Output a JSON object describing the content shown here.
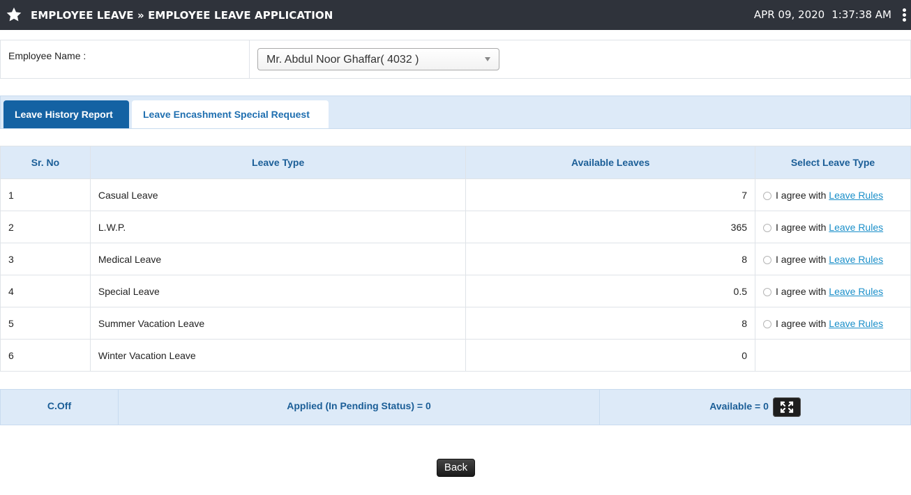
{
  "header": {
    "title": "EMPLOYEE LEAVE » EMPLOYEE LEAVE APPLICATION",
    "date": "APR 09, 2020",
    "time": "1:37:38 AM",
    "star_icon": "star-icon",
    "menu_icon": "kebab-menu-icon"
  },
  "employee": {
    "label": "Employee Name :",
    "selected": "Mr. Abdul Noor Ghaffar( 4032 )"
  },
  "tabs": [
    {
      "label": "Leave History Report",
      "active": true
    },
    {
      "label": "Leave Encashment Special Request",
      "active": false
    }
  ],
  "table": {
    "headers": [
      "Sr. No",
      "Leave Type",
      "Available Leaves",
      "Select Leave Type"
    ],
    "agree_text": "I agree with ",
    "link_text": "Leave Rules",
    "rows": [
      {
        "sr": "1",
        "type": "Casual Leave",
        "available": "7",
        "selectable": true
      },
      {
        "sr": "2",
        "type": "L.W.P.",
        "available": "365",
        "selectable": true
      },
      {
        "sr": "3",
        "type": "Medical Leave",
        "available": "8",
        "selectable": true
      },
      {
        "sr": "4",
        "type": "Special Leave",
        "available": "0.5",
        "selectable": true
      },
      {
        "sr": "5",
        "type": "Summer Vacation Leave",
        "available": "8",
        "selectable": true
      },
      {
        "sr": "6",
        "type": "Winter Vacation Leave",
        "available": "0",
        "selectable": false
      }
    ]
  },
  "coff": {
    "label": "C.Off",
    "applied": "Applied (In Pending Status) = 0",
    "available": "Available = 0",
    "expand_icon": "expand-icon"
  },
  "footer": {
    "back_label": "Back"
  },
  "colors": {
    "header_bg": "#2f333b",
    "tab_active": "#1462a3",
    "table_header_bg": "#ddeaf8",
    "link": "#1a8fc9"
  }
}
